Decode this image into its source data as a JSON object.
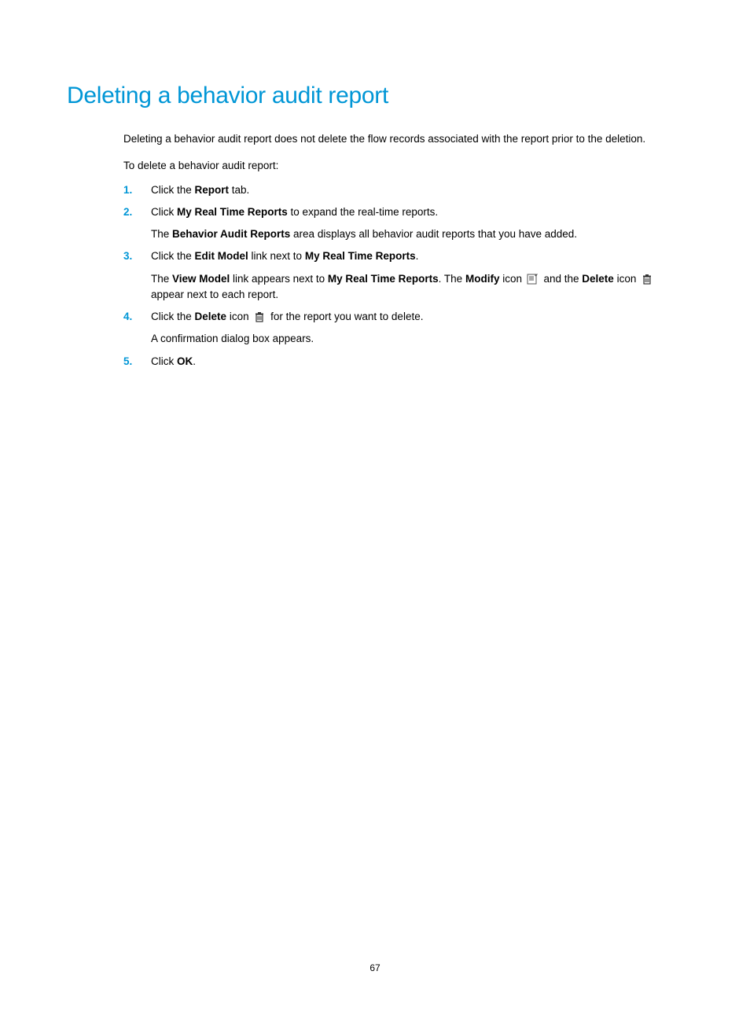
{
  "heading": "Deleting a behavior audit report",
  "intro": "Deleting a behavior audit report does not delete the flow records associated with the report prior to the deletion.",
  "stepsIntro": "To delete a behavior audit report:",
  "steps": {
    "s1": {
      "t1": "Click the ",
      "b1": "Report",
      "t2": " tab."
    },
    "s2": {
      "line1_t1": "Click ",
      "line1_b1": "My Real Time Reports",
      "line1_t2": " to expand the real-time reports.",
      "line2_t1": "The ",
      "line2_b1": "Behavior Audit Reports",
      "line2_t2": " area displays all behavior audit reports that you have added."
    },
    "s3": {
      "line1_t1": "Click the ",
      "line1_b1": "Edit Model",
      "line1_t2": " link next to ",
      "line1_b2": "My Real Time Reports",
      "line1_t3": ".",
      "line2_t1": "The ",
      "line2_b1": "View Model",
      "line2_t2": " link appears next to ",
      "line2_b2": "My Real Time Reports",
      "line2_t3": ". The ",
      "line2_b3": "Modify",
      "line2_t4": " icon ",
      "line2_t5": " and the ",
      "line2_b4": "Delete",
      "line2_t6": " icon ",
      "line2_t7": " appear next to each report."
    },
    "s4": {
      "line1_t1": "Click the ",
      "line1_b1": "Delete",
      "line1_t2": " icon ",
      "line1_t3": " for the report you want to delete.",
      "line2": "A confirmation dialog box appears."
    },
    "s5": {
      "t1": "Click ",
      "b1": "OK",
      "t2": "."
    }
  },
  "pageNumber": "67"
}
